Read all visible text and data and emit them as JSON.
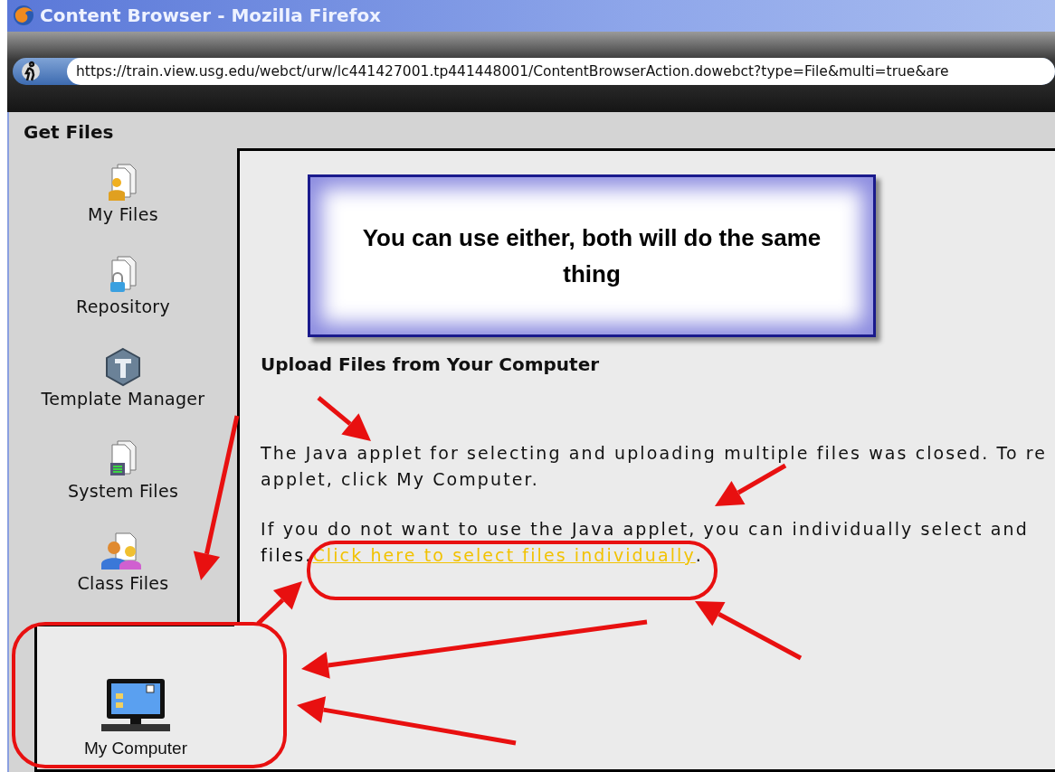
{
  "window": {
    "title": "Content Browser - Mozilla Firefox"
  },
  "address_bar": {
    "value": "https://train.view.usg.edu/webct/urw/lc441427001.tp441448001/ContentBrowserAction.dowebct?type=File&multi=true&are"
  },
  "panel": {
    "title": "Get Files"
  },
  "sidebar": {
    "items": [
      {
        "label": "My Files"
      },
      {
        "label": "Repository"
      },
      {
        "label": "Template Manager"
      },
      {
        "label": "System Files"
      },
      {
        "label": "Class Files"
      }
    ],
    "tab": {
      "label": "My Computer",
      "selected": true
    }
  },
  "callout": {
    "text": "You can use either, both will do the same thing"
  },
  "content": {
    "heading": "Upload Files from Your Computer",
    "paragraph_1": [
      "The Java applet for selecting and uploading multiple files was closed. To re",
      "applet, click My Computer."
    ],
    "paragraph_2": [
      "If you do not want to use the Java applet, you can individually select and"
    ],
    "paragraph_2_prefix": "files. ",
    "link": "Click here to select files individually",
    "paragraph_2_suffix": "."
  }
}
